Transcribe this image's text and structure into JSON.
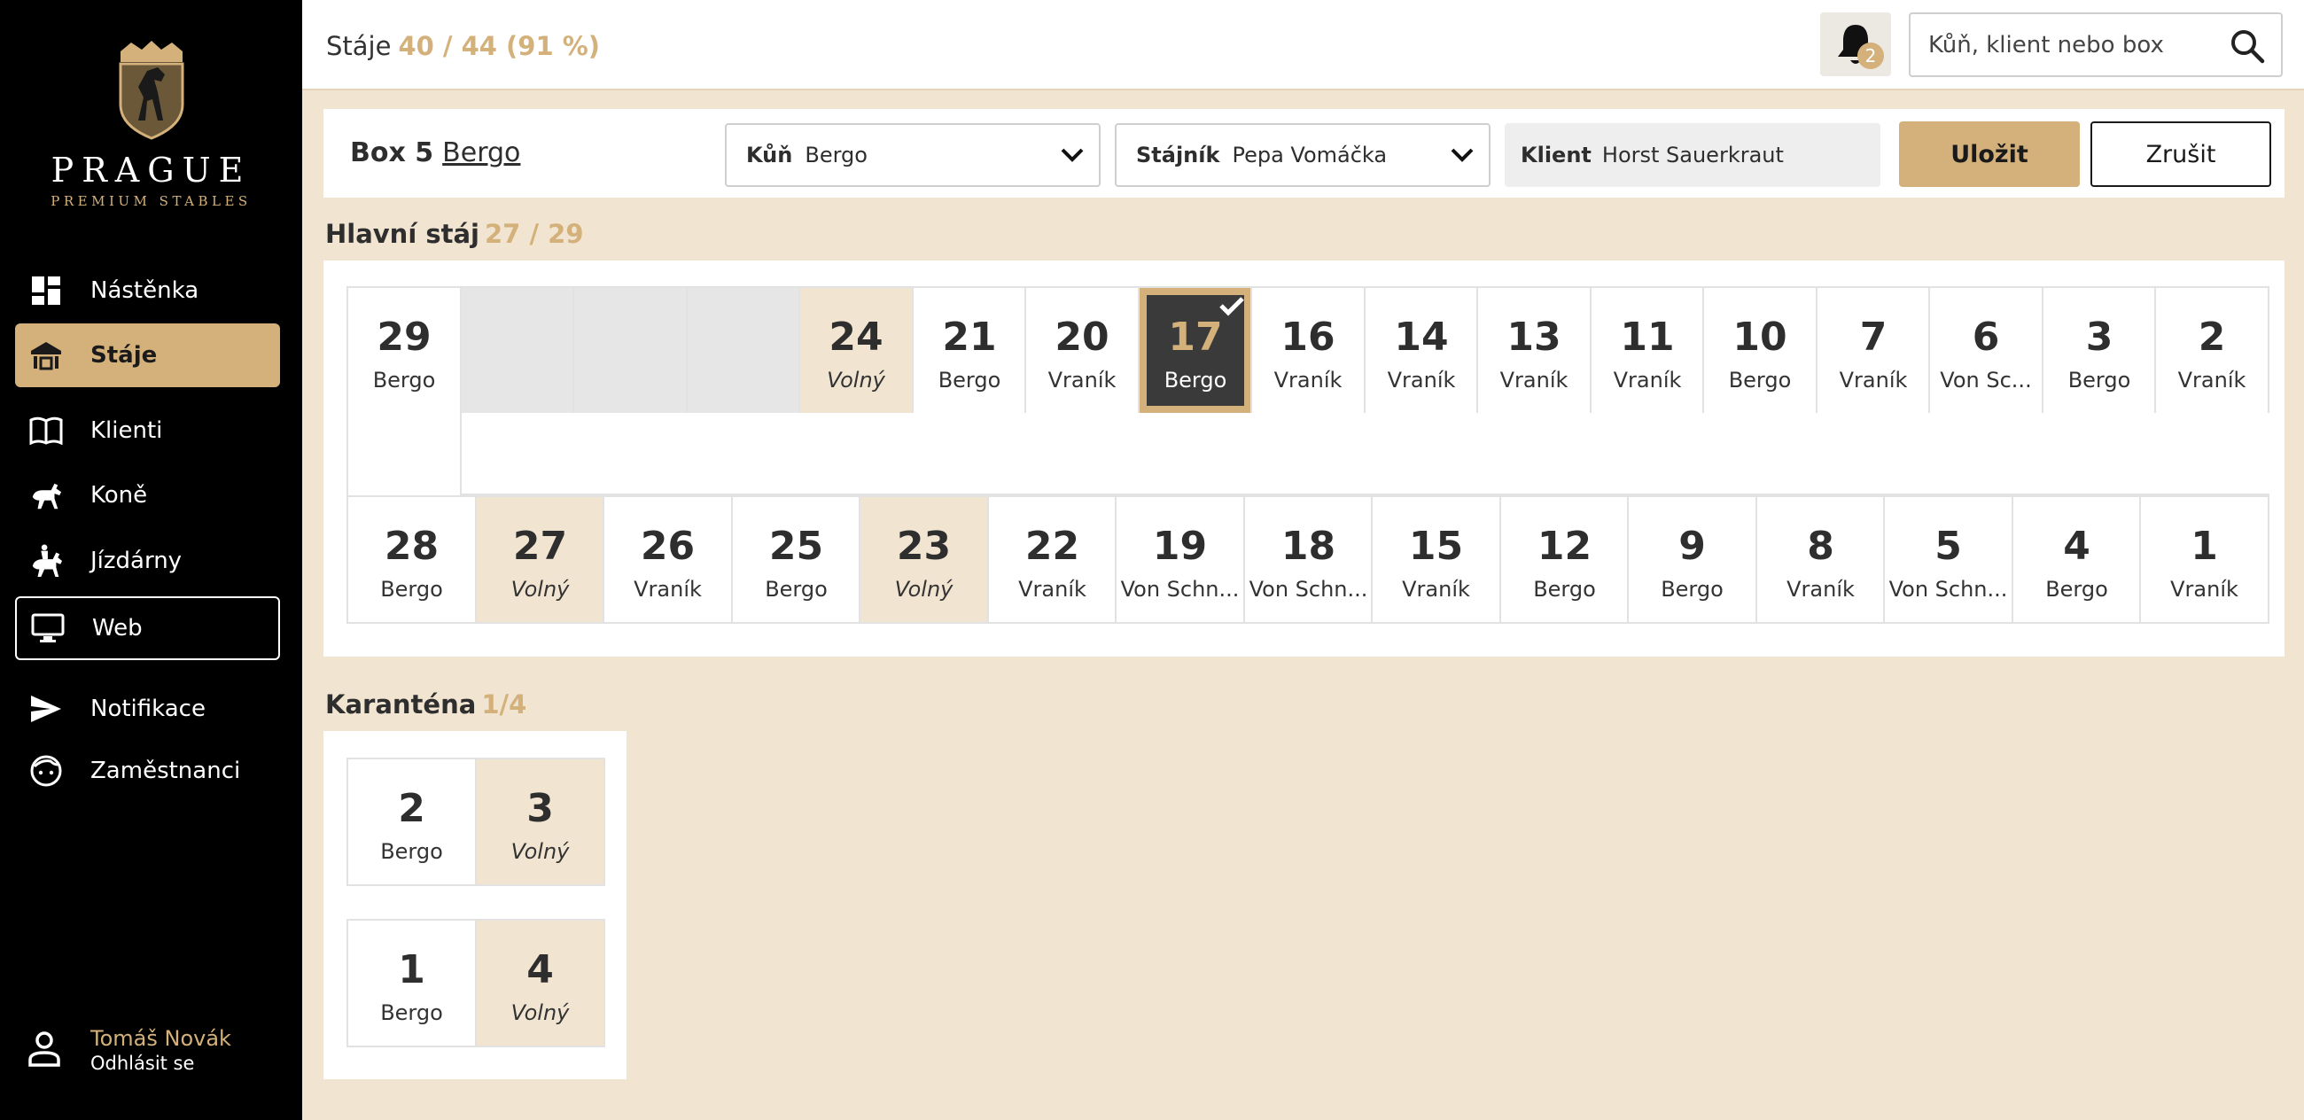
{
  "brand": {
    "title": "PRAGUE",
    "subtitle": "PREMIUM STABLES",
    "accent": "#d4b17a"
  },
  "nav": [
    {
      "label": "Nástěnka",
      "icon": "dashboard-icon",
      "state": "normal"
    },
    {
      "label": "Stáje",
      "icon": "stable-icon",
      "state": "active"
    },
    {
      "label": "Klienti",
      "icon": "book-icon",
      "state": "normal"
    },
    {
      "label": "Koně",
      "icon": "horse-icon",
      "state": "normal"
    },
    {
      "label": "Jízdárny",
      "icon": "rider-icon",
      "state": "normal"
    },
    {
      "label": "Web",
      "icon": "monitor-icon",
      "state": "outlined"
    },
    {
      "label": "Notifikace",
      "icon": "send-icon",
      "state": "normal"
    },
    {
      "label": "Zaměstnanci",
      "icon": "face-icon",
      "state": "normal"
    }
  ],
  "user": {
    "name": "Tomáš Novák",
    "logout": "Odhlásit se"
  },
  "header": {
    "title": "Stáje",
    "stats": "40 / 44 (91 %)",
    "notifications": "2",
    "search_placeholder": "Kůň, klient nebo box"
  },
  "editor": {
    "box_label": "Box 5",
    "box_horse": "Bergo",
    "horse_label": "Kůň",
    "horse_value": "Bergo",
    "groom_label": "Stájník",
    "groom_value": "Pepa Vomáčka",
    "client_label": "Klient",
    "client_value": "Horst Sauerkraut",
    "save": "Uložit",
    "cancel": "Zrušit"
  },
  "main_stable": {
    "title": "Hlavní stáj",
    "count": "27 / 29",
    "top_row": [
      {
        "num": "29",
        "name": "Bergo",
        "status": "occupied"
      },
      {
        "num": "",
        "name": "",
        "status": "empty"
      },
      {
        "num": "",
        "name": "",
        "status": "empty"
      },
      {
        "num": "",
        "name": "",
        "status": "empty"
      },
      {
        "num": "24",
        "name": "Volný",
        "status": "free"
      },
      {
        "num": "21",
        "name": "Bergo",
        "status": "occupied"
      },
      {
        "num": "20",
        "name": "Vraník",
        "status": "occupied"
      },
      {
        "num": "17",
        "name": "Bergo",
        "status": "selected"
      },
      {
        "num": "16",
        "name": "Vraník",
        "status": "occupied"
      },
      {
        "num": "14",
        "name": "Vraník",
        "status": "occupied"
      },
      {
        "num": "13",
        "name": "Vraník",
        "status": "occupied"
      },
      {
        "num": "11",
        "name": "Vraník",
        "status": "occupied"
      },
      {
        "num": "10",
        "name": "Bergo",
        "status": "occupied"
      },
      {
        "num": "7",
        "name": "Vraník",
        "status": "occupied"
      },
      {
        "num": "6",
        "name": "Von Sc...",
        "status": "occupied"
      },
      {
        "num": "3",
        "name": "Bergo",
        "status": "occupied"
      },
      {
        "num": "2",
        "name": "Vraník",
        "status": "occupied"
      }
    ],
    "bottom_row": [
      {
        "num": "28",
        "name": "Bergo",
        "status": "occupied"
      },
      {
        "num": "27",
        "name": "Volný",
        "status": "free"
      },
      {
        "num": "26",
        "name": "Vraník",
        "status": "occupied"
      },
      {
        "num": "25",
        "name": "Bergo",
        "status": "occupied"
      },
      {
        "num": "23",
        "name": "Volný",
        "status": "free"
      },
      {
        "num": "22",
        "name": "Vraník",
        "status": "occupied"
      },
      {
        "num": "19",
        "name": "Von Schn...",
        "status": "occupied"
      },
      {
        "num": "18",
        "name": "Von Schn...",
        "status": "occupied"
      },
      {
        "num": "15",
        "name": "Vraník",
        "status": "occupied"
      },
      {
        "num": "12",
        "name": "Bergo",
        "status": "occupied"
      },
      {
        "num": "9",
        "name": "Bergo",
        "status": "occupied"
      },
      {
        "num": "8",
        "name": "Vraník",
        "status": "occupied"
      },
      {
        "num": "5",
        "name": "Von Schn...",
        "status": "occupied"
      },
      {
        "num": "4",
        "name": "Bergo",
        "status": "occupied"
      },
      {
        "num": "1",
        "name": "Vraník",
        "status": "occupied"
      }
    ]
  },
  "quarantine": {
    "title": "Karanténa",
    "count": "1/4",
    "rows": [
      [
        {
          "num": "2",
          "name": "Bergo",
          "status": "occupied"
        },
        {
          "num": "3",
          "name": "Volný",
          "status": "free"
        }
      ],
      [
        {
          "num": "1",
          "name": "Bergo",
          "status": "occupied"
        },
        {
          "num": "4",
          "name": "Volný",
          "status": "free"
        }
      ]
    ]
  }
}
